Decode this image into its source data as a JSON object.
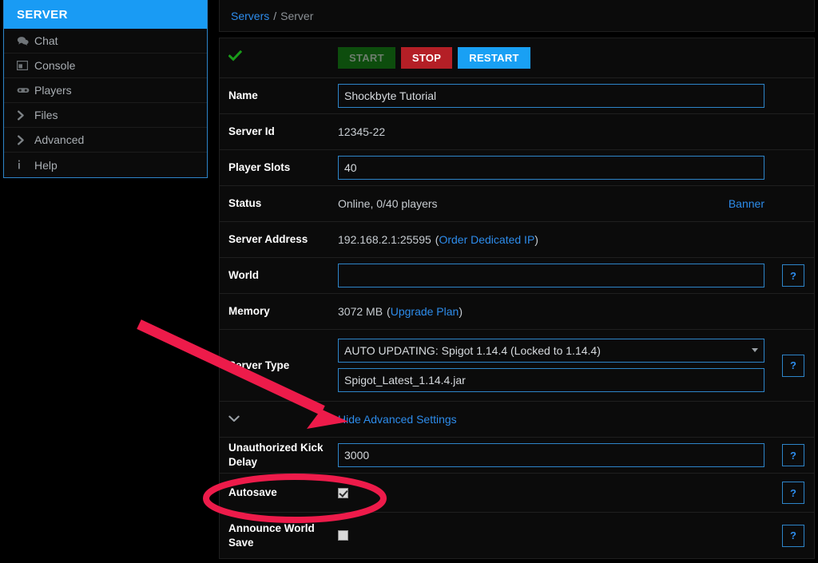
{
  "sidebar": {
    "header": "SERVER",
    "items": [
      {
        "label": "Chat",
        "icon": "chat-icon"
      },
      {
        "label": "Console",
        "icon": "console-icon"
      },
      {
        "label": "Players",
        "icon": "players-icon"
      },
      {
        "label": "Files",
        "icon": "chevron-right-icon"
      },
      {
        "label": "Advanced",
        "icon": "chevron-right-icon"
      },
      {
        "label": "Help",
        "icon": "info-icon"
      }
    ]
  },
  "breadcrumb": {
    "root": "Servers",
    "separator": "/",
    "current": "Server"
  },
  "controls": {
    "status_icon": "green-check-icon",
    "start": "START",
    "stop": "STOP",
    "restart": "RESTART"
  },
  "form": {
    "name_label": "Name",
    "name_value": "Shockbyte Tutorial",
    "server_id_label": "Server Id",
    "server_id_value": "12345-22",
    "player_slots_label": "Player Slots",
    "player_slots_value": "40",
    "status_label": "Status",
    "status_value": "Online, 0/40 players",
    "banner_link": "Banner",
    "server_address_label": "Server Address",
    "server_address_value": "192.168.2.1:25595",
    "order_ip_link": "Order Dedicated IP",
    "world_label": "World",
    "world_value": "",
    "memory_label": "Memory",
    "memory_value": "3072 MB",
    "upgrade_plan_link": "Upgrade Plan",
    "server_type_label": "Server Type",
    "server_type_selected": "AUTO UPDATING: Spigot 1.14.4 (Locked to 1.14.4)",
    "server_jar_value": "Spigot_Latest_1.14.4.jar",
    "toggle_advanced_link": "Hide Advanced Settings",
    "toggle_advanced_icon": "chevron-down-icon",
    "kick_delay_label": "Unauthorized Kick Delay",
    "kick_delay_value": "3000",
    "autosave_label": "Autosave",
    "autosave_checked": true,
    "announce_world_save_label": "Announce World Save",
    "announce_world_save_checked": false,
    "help_symbol": "?",
    "paren_open": "(",
    "paren_close": ")"
  },
  "annotations": {
    "arrow_color": "#ED1B4A",
    "ellipse_color": "#ED1B4A",
    "arrow_target": "Hide Advanced Settings",
    "ellipse_target": "Autosave"
  },
  "colors": {
    "accent_blue": "#199bf4",
    "link_blue": "#2d8ceb",
    "border_blue": "#2d85c9",
    "stop_red": "#b41f26",
    "start_green": "#0d4d0d",
    "check_green": "#1a9b1a",
    "background": "#000000",
    "panel_bg": "#0b0b0b"
  }
}
